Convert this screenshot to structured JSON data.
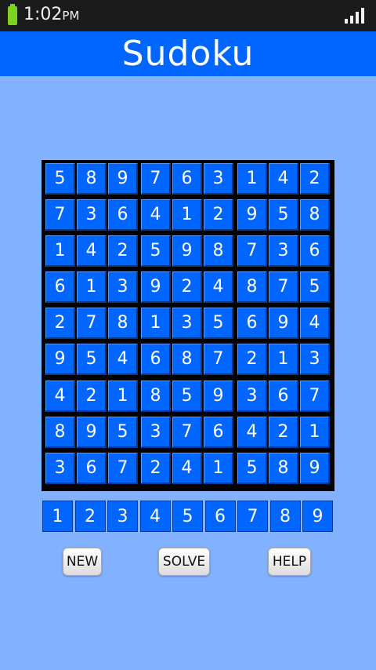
{
  "status_bar": {
    "time": "1:02",
    "ampm": "PM"
  },
  "app": {
    "title": "Sudoku"
  },
  "board": {
    "rows": [
      [
        5,
        8,
        9,
        7,
        6,
        3,
        1,
        4,
        2
      ],
      [
        7,
        3,
        6,
        4,
        1,
        2,
        9,
        5,
        8
      ],
      [
        1,
        4,
        2,
        5,
        9,
        8,
        7,
        3,
        6
      ],
      [
        6,
        1,
        3,
        9,
        2,
        4,
        8,
        7,
        5
      ],
      [
        2,
        7,
        8,
        1,
        3,
        5,
        6,
        9,
        4
      ],
      [
        9,
        5,
        4,
        6,
        8,
        7,
        2,
        1,
        3
      ],
      [
        4,
        2,
        1,
        8,
        5,
        9,
        3,
        6,
        7
      ],
      [
        8,
        9,
        5,
        3,
        7,
        6,
        4,
        2,
        1
      ],
      [
        3,
        6,
        7,
        2,
        4,
        1,
        5,
        8,
        9
      ]
    ]
  },
  "numpad": {
    "keys": [
      1,
      2,
      3,
      4,
      5,
      6,
      7,
      8,
      9
    ]
  },
  "buttons": {
    "new": "NEW",
    "solve": "SOLVE",
    "help": "HELP"
  },
  "colors": {
    "page_bg": "#82b1ff",
    "accent": "#0066ff",
    "status_bg": "#1b1b1b",
    "battery": "#7ed321"
  }
}
